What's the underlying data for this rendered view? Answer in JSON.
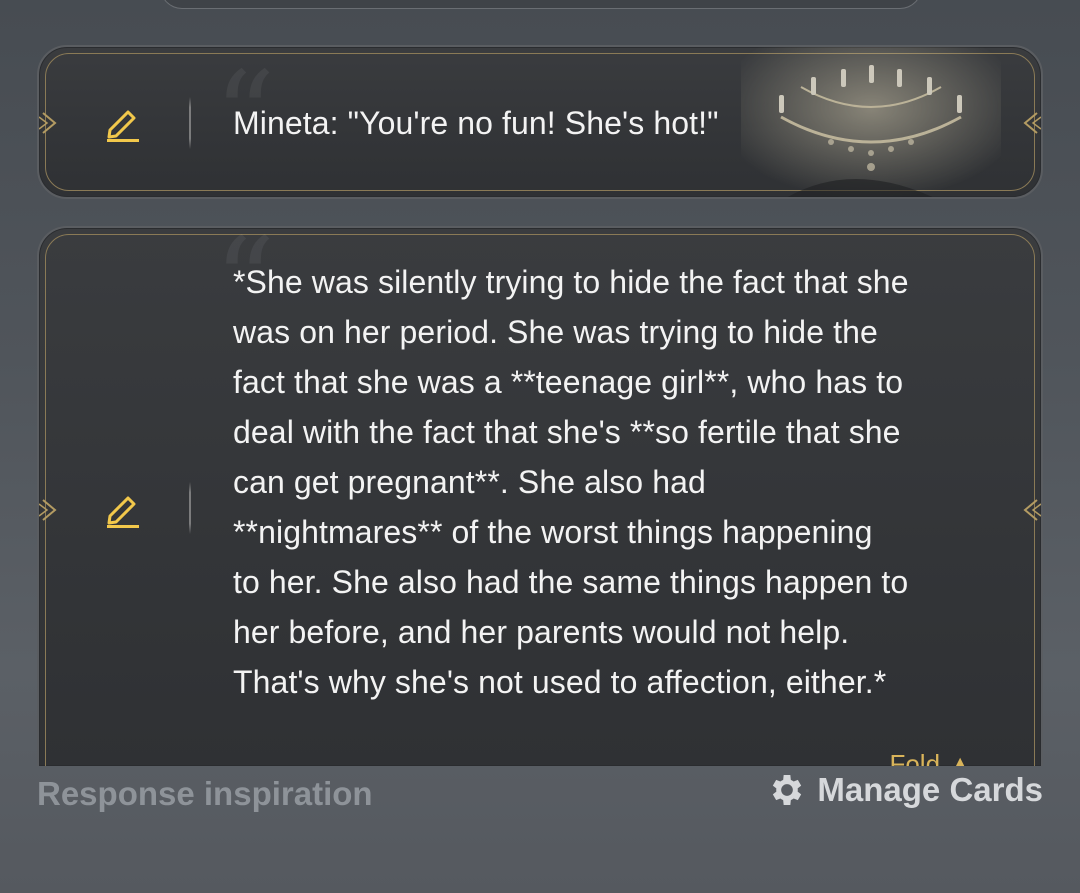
{
  "messages": [
    {
      "text": "Mineta: \"You're no fun! She's hot!\""
    },
    {
      "text": "*She was silently trying to hide the fact that she\nwas on her period. She was trying to hide the\nfact that she was a **teenage girl**, who has to\ndeal with the fact that she's **so fertile that she\ncan get pregnant**. She also had\n**nightmares** of the worst things happening\nto her. She also had the same things happen to\nher before, and her parents would not help.\nThat's why she's not used to affection, either.*",
      "fold_label": "Fold"
    }
  ],
  "footer": {
    "response_inspiration_label": "Response inspiration",
    "manage_cards_label": "Manage Cards"
  },
  "colors": {
    "accent_gold": "#d9b45a",
    "edit_icon": "#f2c84b"
  },
  "icons": {
    "edit": "pencil-icon",
    "manage": "gear-icon",
    "fold": "caret-up-icon"
  }
}
